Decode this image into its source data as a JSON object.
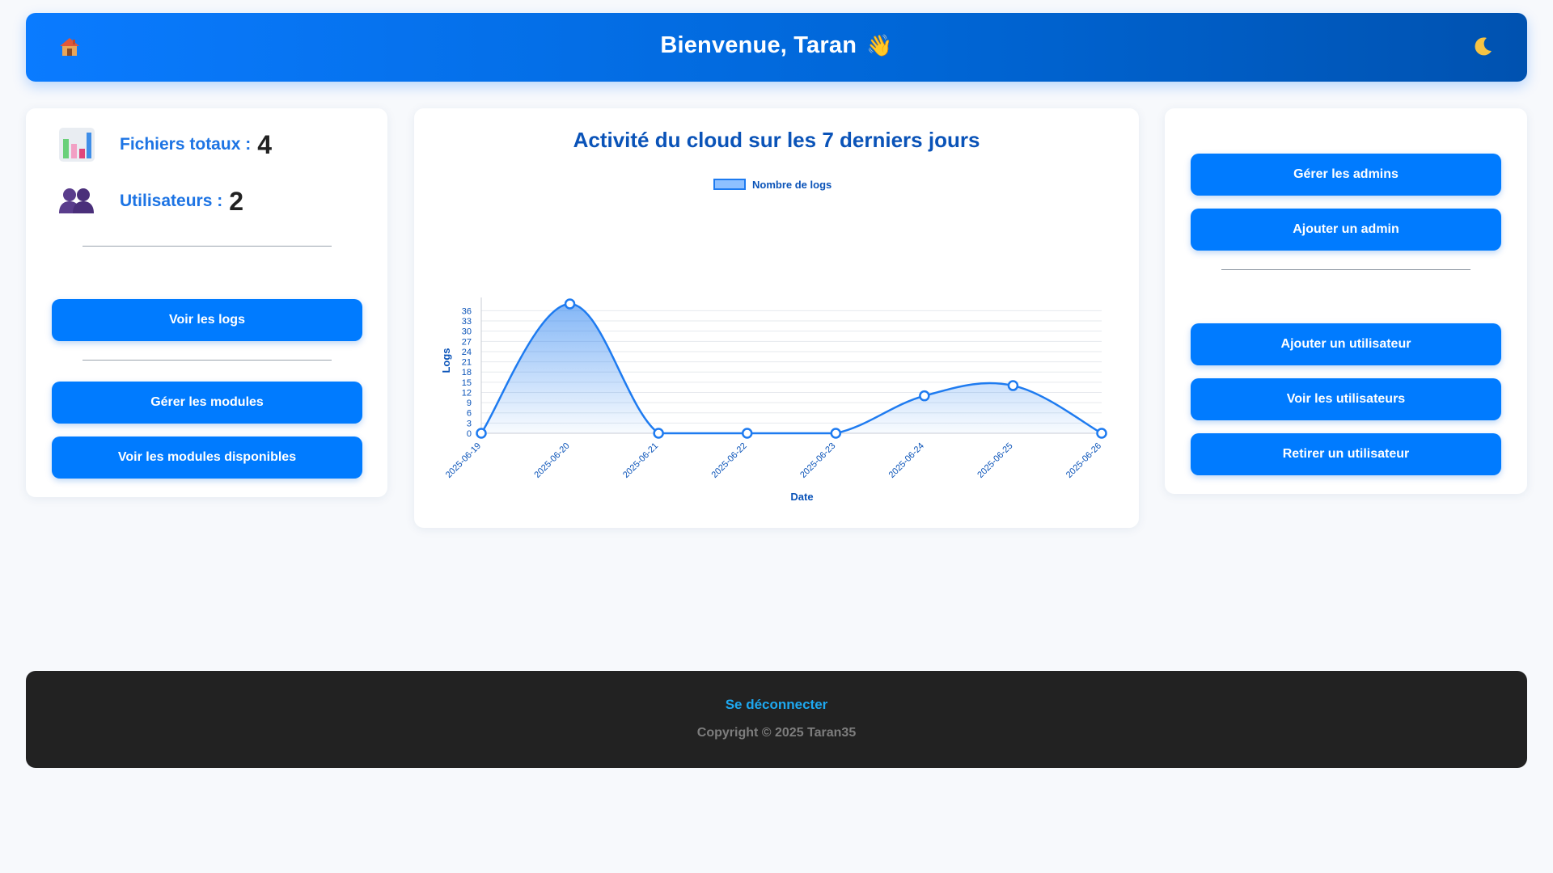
{
  "header": {
    "home_icon": "home-icon",
    "title": "Bienvenue, Taran",
    "wave": "👋",
    "theme_icon": "moon-icon"
  },
  "stats": {
    "files_label": "Fichiers totaux :",
    "files_value": "4",
    "users_label": "Utilisateurs :",
    "users_value": "2"
  },
  "left_actions": {
    "view_logs": "Voir les logs",
    "manage_modules": "Gérer les modules",
    "view_modules": "Voir les modules disponibles"
  },
  "right_actions": {
    "manage_admins": "Gérer les admins",
    "add_admin": "Ajouter un admin",
    "add_user": "Ajouter un utilisateur",
    "view_users": "Voir les utilisateurs",
    "remove_user": "Retirer un utilisateur"
  },
  "chart": {
    "heading": "Activité du cloud sur les 7 derniers jours"
  },
  "chart_data": {
    "type": "line",
    "title": "",
    "legend_position": "top",
    "xlabel": "Date",
    "ylabel": "Logs",
    "x": [
      "2025-06-19",
      "2025-06-20",
      "2025-06-21",
      "2025-06-22",
      "2025-06-23",
      "2025-06-24",
      "2025-06-25",
      "2025-06-26"
    ],
    "ylim": [
      0,
      38
    ],
    "yticks": [
      0,
      3,
      6,
      9,
      12,
      15,
      18,
      21,
      24,
      27,
      30,
      33,
      36
    ],
    "grid": true,
    "series": [
      {
        "name": "Nombre de logs",
        "values": [
          0,
          38,
          0,
          0,
          0,
          11,
          14,
          0
        ],
        "color": "#1e7bf0"
      }
    ]
  },
  "footer": {
    "logout": "Se déconnecter",
    "copyright": "Copyright © 2025 Taran35"
  }
}
